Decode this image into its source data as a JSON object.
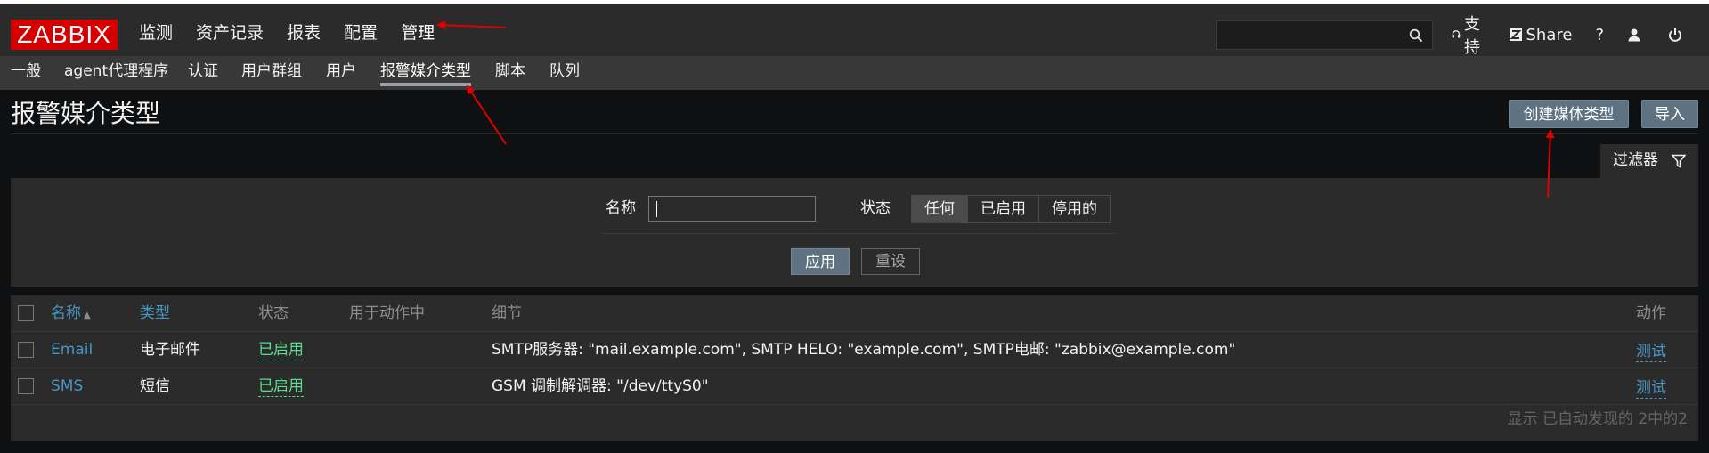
{
  "header": {
    "logo": "ZABBIX",
    "main_menu": [
      "监测",
      "资产记录",
      "报表",
      "配置",
      "管理"
    ],
    "search_placeholder": "",
    "links": {
      "support": "支持",
      "share": "Share",
      "help": "?"
    }
  },
  "submenu": [
    "一般",
    "agent代理程序",
    "认证",
    "用户群组",
    "用户",
    "报警媒介类型",
    "脚本",
    "队列"
  ],
  "page": {
    "title": "报警媒介类型",
    "create_button": "创建媒体类型",
    "import_button": "导入"
  },
  "filter": {
    "tab_label": "过滤器",
    "name_label": "名称",
    "name_value": "",
    "status_label": "状态",
    "status_options": [
      "任何",
      "已启用",
      "停用的"
    ],
    "status_selected": "任何",
    "apply_button": "应用",
    "reset_button": "重设"
  },
  "table": {
    "headers": {
      "name": "名称",
      "sort_arrow": "▲",
      "type": "类型",
      "status": "状态",
      "used_in_actions": "用于动作中",
      "details": "细节",
      "actions": "动作"
    },
    "rows": [
      {
        "name": "Email",
        "type": "电子邮件",
        "status": "已启用",
        "used": "",
        "details": "SMTP服务器: \"mail.example.com\", SMTP HELO: \"example.com\", SMTP电邮: \"zabbix@example.com\"",
        "action": "测试"
      },
      {
        "name": "SMS",
        "type": "短信",
        "status": "已启用",
        "used": "",
        "details": "GSM 调制解调器: \"/dev/ttyS0\"",
        "action": "测试"
      }
    ],
    "footer": "显示 已自动发现的 2中的2"
  },
  "colors": {
    "logo_bg": "#d40000",
    "header_bg": "#2b2b2b",
    "accent_button": "#5e7282",
    "link": "#4796c4",
    "enabled": "#59db8f",
    "annotation": "#e00000"
  }
}
